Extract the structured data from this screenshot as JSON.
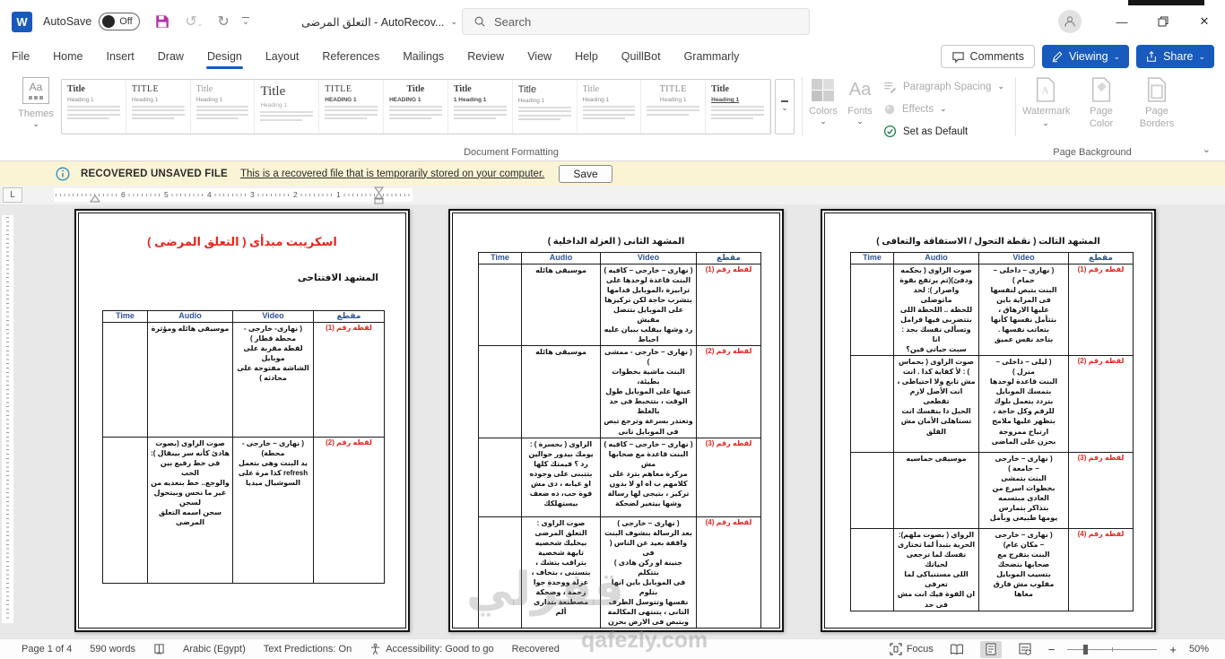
{
  "colors": {
    "accent_blue": "#185ABD",
    "table_header_blue": "#2F5496",
    "doc_red": "#e8251d",
    "recovery_yellow": "#FAF4D5"
  },
  "titlebar": {
    "autosave_label": "AutoSave",
    "autosave_state": "Off",
    "doc_title": "التعلق المرضى  -  AutoRecov...",
    "search_placeholder": "Search"
  },
  "ribbon": {
    "tabs": [
      "File",
      "Home",
      "Insert",
      "Draw",
      "Design",
      "Layout",
      "References",
      "Mailings",
      "Review",
      "View",
      "Help",
      "QuillBot",
      "Grammarly"
    ],
    "comments_label": "Comments",
    "viewing_label": "Viewing",
    "share_label": "Share",
    "themes_label": "Themes",
    "gallery": [
      {
        "t": "Title",
        "h": "Heading 1"
      },
      {
        "t": "TITLE",
        "h": "Heading 1"
      },
      {
        "t": "Title",
        "h": "Heading 1"
      },
      {
        "t": "Title",
        "h": "Heading 1"
      },
      {
        "t": "TITLE",
        "h": "HEADING 1"
      },
      {
        "t": "Title",
        "h": "HEADING 1"
      },
      {
        "t": "Title",
        "h": "1  Heading 1"
      },
      {
        "t": "Title",
        "h": "Heading 1"
      },
      {
        "t": "Title",
        "h": "Heading 1"
      },
      {
        "t": "TITLE",
        "h": "Heading 1"
      },
      {
        "t": "Title",
        "h": "Heading 1"
      }
    ],
    "colors_label": "Colors",
    "fonts_label": "Fonts",
    "paragraph_spacing_label": "Paragraph Spacing",
    "effects_label": "Effects",
    "set_default_label": "Set as Default",
    "watermark_label": "Watermark",
    "page_color_label": "Page Color",
    "page_borders_label": "Page Borders",
    "group_document_formatting": "Document Formatting",
    "group_page_background": "Page Background"
  },
  "recovery_bar": {
    "title": "RECOVERED UNSAVED FILE",
    "message": "This is a recovered file that is temporarily stored on your computer.",
    "save_label": "Save"
  },
  "ruler": {
    "tab_selector": "L",
    "numbers": [
      "6",
      "5",
      "4",
      "3",
      "2",
      "1"
    ]
  },
  "document": {
    "watermark_ar": "قفزلي",
    "watermark_en": "qafezly.com",
    "pages": [
      {
        "title": "اسكريبت مبدأى ( التعلق المرضى )",
        "subtitle": "المشهد الافتتاحى",
        "table": {
          "headers": [
            "Time",
            "Audio",
            "Video",
            "مقطع"
          ],
          "rows": [
            {
              "time": "",
              "audio": "موسيقى هائله ومؤثرة",
              "video": "( نهارى- خارجى -\nمحطة قطار )\nلقطة مقربة على موبايل\nالشاشة مفتوحة على\nمحادثه )",
              "clip": "لقطه رقم (1)"
            },
            {
              "time": "",
              "audio": "صوت الراوى (بصوت\nهادئ كأنه سر بينقال ):\nفى خط رفيع بين الحب\nوالوجع.. خط بنعديه من\nغير ما نحس وبيتحول\nلسجن\nسجن اسمه التعلق\nالمرضى",
              "video": "( نهارى – خارجى -\nمحطة)\nيد البنت وهى بتعمل\nrefresh كذا مرة على\nالسوشيال ميديا",
              "clip": "لقطه رقم (2)"
            }
          ]
        }
      },
      {
        "title": "المشهد الثانى  ( العزلة الداخلية )",
        "table": {
          "headers": [
            "Time",
            "Audio",
            "Video",
            "مقطع"
          ],
          "rows": [
            {
              "time": "",
              "audio": "موسيقى هائله",
              "video": "( نهارى – خارجى – كافيه )\nالبنت قاعدة لوحدها على\nترابيزة ،الموبايل قدامها\nبتشرب حاجة لكن تركيزها\nعلى الموبايل بتتصل مفيش\nرد وشها بيقلب ببيان عليه\nاحباط",
              "clip": "لقطه رقم (1)"
            },
            {
              "time": "",
              "audio": "موسيقى هائله",
              "video": "( نهارى – خارجى - ممشى )\nالبنت ماشية بخطوات بطيئة،\nعينها على الموبايل طول\nالوقت ، بتتخبط فى حد بالغلط\nوتعتذر بسرعة وترجع تبص\nفى الموبايل تانى",
              "clip": "لقطه رقم (2)"
            },
            {
              "time": "",
              "audio": "الراوى ( بحسرة ) :\nيومك بيدور حوالين\nرد ؟ قيمتك كلها\nبتتبنى على وجوده\nاو غيابه ، دى مش\nقوة حب، ده ضعف\nبيستهلكك",
              "video": "( نهارى – خارجى – كافيه )\nالبنت قاعدة مع صحابها مش\nمركزة معاهم بترد على\nكلامهم ب اه او لا بدون\nتركيز ، بتيجى لها رسالة\nوشها بيتغير لضحكة",
              "clip": "لقطه رقم (3)"
            },
            {
              "time": "",
              "audio": "صوت الراوى :\nالتعلق المرضى\nبيخليك شخصيه\nتايهة شخصية\nبتراقب بتشك ،\nبتستنى ، بتخاف ،\nعزلة ووحدة جوا\nزحمة ، وضحكة\nمصطنعة بتدارى\nألم",
              "video": "( نهارى – خارجى )\nبعد الرسالة بنشوف البنت\nواقفة بعيد عن الناس ( فى\nجنينة او ركن هادى ) بتتكلم\nفى الموبايل باين انها بتلوم\nنفسها وتتوسل الطرف\nالتانى ، بتنتهى المكالمة\nوبتبص فى الارض بحزن\nوتكتم دموعها",
              "clip": "لقطه رقم (4)"
            }
          ]
        }
      },
      {
        "title": "المشهد التالت ( نقطة التحول / الاستفاقة والتعافى )",
        "table": {
          "headers": [
            "Time",
            "Audio",
            "Video",
            "مقطع"
          ],
          "rows": [
            {
              "time": "",
              "audio": "صوت الراوى ( بحكمه\nودفئ)(ثم يرتفع بقوة\nواصرار ): لحد ماتوصلى\nللحظة .. اللحظة اللى\nبتتضربى فيها فرامل\nوتسألى نفسك بجد : انا\nسبت حياتى فين؟",
              "video": "( نهارى – داخلى –\nحمام )\nالبنت بتبص لنفسها\nفى المراية باين\nعليها الارهاق ،\nبتتأمل نفسها كأنها\nبتعاتب نفسها .\nبتاخد نفس عميق",
              "clip": "لقطه رقم (1)"
            },
            {
              "time": "",
              "audio": "صوت الراوى ( بحماس\n) : لأ كفاية كدا . انت\nمش تابع ولا احتياطى ،\nانت الأصل لازم تقطعى\nالحبل دا بنفسك انت\nتستاهلى الأمان مش\nالقلق",
              "video": "( ليلى – داخلى –\nمنزل )\nالبنت قاعدة لوحدها\nبتمسك الموبايل\nبتردد بتعمل بلوك\nللرقم وكل حاجة ،\nبتظهر عليها ملامح\nارتياح ممزوجة\nبحزن على الماضى",
              "clip": "لقطه رقم (2)"
            },
            {
              "time": "",
              "audio": "موسيقى حماسيه",
              "video": "( نهارى – خارجى\n– جامعة )\nالبنت بتمشى\nبخطوات اسرع من\nالعادى مبتسمه\nبتذاكر بتمارس\nيومها طبيعى وبأمل",
              "clip": "لقطه رقم (3)"
            },
            {
              "time": "",
              "audio": "الرواي ( بصوت ملهم):\nالحرية بتبدأ لما تختارى\nنفسك لما ترجعى لحياتك\nاللى مستنياكى لما تعرفى\nان القوة فيك انت مش\nفى حد",
              "video": "( نهارى – خارجى\n– مكان عام)\nالبنت بتفرج مع\nصحابها بتضحك\nبتسيب الموبايل\nمقلوب مش فارق\nمعاها",
              "clip": "لقطه رقم (4)"
            }
          ]
        }
      }
    ]
  },
  "statusbar": {
    "page_info": "Page 1 of 4",
    "word_count": "590 words",
    "language": "Arabic (Egypt)",
    "text_predictions": "Text Predictions: On",
    "accessibility": "Accessibility: Good to go",
    "recovered": "Recovered",
    "focus_label": "Focus",
    "zoom_level": "50%"
  }
}
